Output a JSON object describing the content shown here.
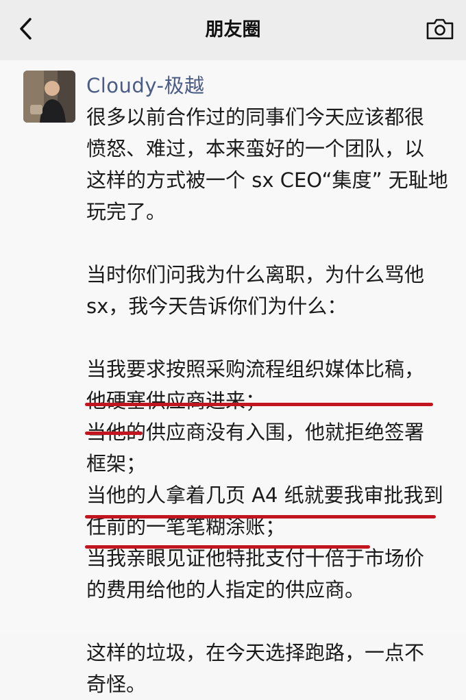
{
  "navbar": {
    "title": "朋友圈",
    "back_icon": "chevron-left-icon",
    "camera_icon": "camera-icon"
  },
  "post": {
    "author": "Cloudy-极越",
    "lines": [
      "很多以前合作过的同事们今天应该都很",
      "愤怒、难过，本来蛮好的一个团队，以",
      "这样的方式被一个 sx CEO“集度” 无耻地",
      "玩完了。",
      "",
      "当时你们问我为什么离职，为什么骂他",
      "sx，我今天告诉你们为什么：",
      "",
      "当我要求按照采购流程组织媒体比稿，",
      "他硬塞供应商进来；",
      "当他的供应商没有入围，他就拒绝签署",
      "框架；",
      "当他的人拿着几页 A4 纸就要我审批我到",
      "任前的一笔笔糊涂账；",
      "当我亲眼见证他特批支付十倍于市场价",
      "的费用给他的人指定的供应商。",
      "",
      "这样的垃圾，在今天选择跑路，一点不",
      "奇怪。"
    ]
  },
  "colors": {
    "author_name": "#4a5c86",
    "underline": "#c3151f",
    "navbar_bg": "#ededed"
  }
}
